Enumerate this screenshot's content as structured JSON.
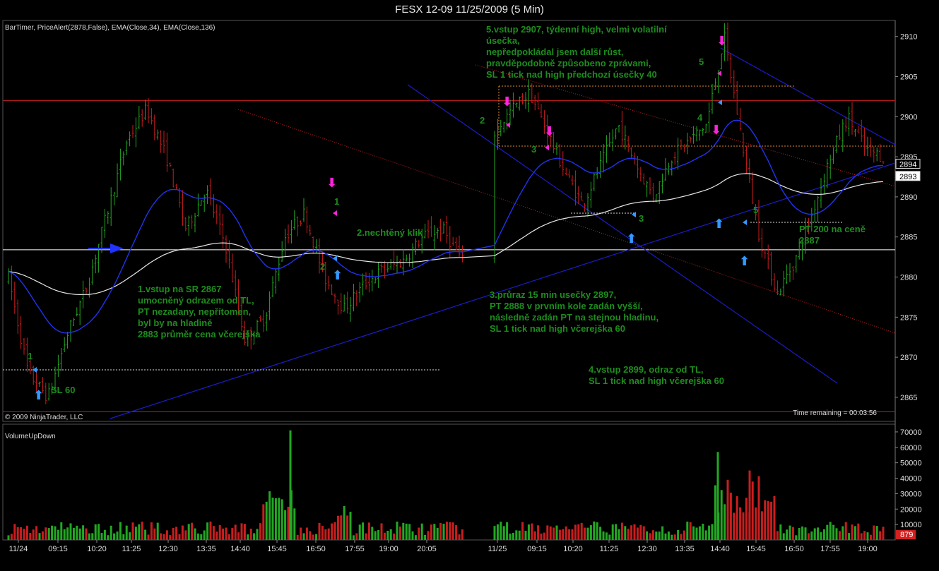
{
  "window": {
    "title": "FESX 12-09  11/25/2009 (5 Min)"
  },
  "colors": {
    "background": "#000000",
    "up_bar": "#22a822",
    "down_bar": "#c81e1e",
    "ema34": "#2233ee",
    "ema136": "#e8e8e8",
    "trendline": "#1c1cc8",
    "annotation": "#1e8c1e",
    "signal_magenta": "#ff22dd",
    "signal_cyan": "#3399ff",
    "hline_red": "#c81e1e",
    "hline_white": "#ffffff"
  },
  "chart_data": [
    {
      "type": "candlestick",
      "name": "price-panel",
      "indicators_label": "BarTimer, PriceAlert(2878,False), EMA(Close,34), EMA(Close,136)",
      "copyright": "© 2009 NinjaTrader, LLC",
      "time_remaining": "Time remaining = 00:03:56",
      "ylim": [
        2862,
        2912
      ],
      "y_ticks": [
        2865,
        2870,
        2875,
        2880,
        2885,
        2890,
        2895,
        2900,
        2905,
        2910
      ],
      "last_price_labels": [
        {
          "value": 2894,
          "text": "2894"
        },
        {
          "value": 2893,
          "text": "2893"
        }
      ],
      "horizontal_lines": [
        {
          "price": 2902.0,
          "color": "red"
        },
        {
          "price": 2883.4,
          "color": "white"
        },
        {
          "price": 2863.2,
          "color": "red"
        }
      ],
      "markers": [
        {
          "text": "1",
          "time": "09:00",
          "price": 2869.5
        },
        {
          "text": "2",
          "time": "17:06",
          "price": 2881.2
        },
        {
          "text": "1",
          "time": "17:12",
          "price": 2889.4
        },
        {
          "text": "2",
          "time": "09:00",
          "price": 2898.4
        },
        {
          "text": "3",
          "time": "09:40",
          "price": 2896.5
        },
        {
          "text": "3",
          "time": "12:05",
          "price": 2887.6
        },
        {
          "text": "4",
          "time": "14:27",
          "price": 2899.5
        },
        {
          "text": "5",
          "time": "14:20",
          "price": 2909.1
        },
        {
          "text": "5",
          "time": "15:20",
          "price": 2888.5
        }
      ],
      "annotations": [
        "1.vstup na SR 2867",
        "umocněný odrazem od TL,",
        "PT nezadany, nepřítomen,",
        "byl by na hladině",
        "2883 průměr cena včerejška",
        "SL 60",
        "2.nechtěný klik",
        "3.průraz 15 min usečky 2897,",
        "PT 2888 v prvním kole zadán vyšší,",
        "následně zadán PT na stejnou hladinu,",
        "SL 1 tick nad high včerejška 60",
        "4.vstup 2899, odraz od TL,",
        "SL 1 tick nad high včerejška 60",
        "5.vstup 2907, týdenní high, velmi volatilní",
        "úsečka,",
        "nepředpokládal jsem další růst,",
        "pravděpodobně způsobeno zprávami,",
        "SL 1 tick nad high předchozí úsečky 40",
        "PT 200 na ceně",
        "2887"
      ],
      "series_shape": [
        {
          "segment": "11/24",
          "path": [
            2880,
            2868,
            2865,
            2873,
            2879,
            2888,
            2897,
            2901,
            2895,
            2886,
            2891,
            2884,
            2872,
            2875,
            2885,
            2888,
            2880,
            2876,
            2879,
            2881,
            2882,
            2885,
            2886,
            2882
          ]
        },
        {
          "segment": "11/25",
          "path": [
            2898,
            2901,
            2903,
            2898,
            2893,
            2889,
            2894,
            2899,
            2894,
            2890,
            2895,
            2897,
            2899,
            2910,
            2897,
            2885,
            2878,
            2882,
            2888,
            2895,
            2900,
            2896,
            2895
          ]
        }
      ]
    },
    {
      "type": "bar",
      "name": "VolumeUpDown",
      "label": "VolumeUpDown",
      "ylim": [
        0,
        75000
      ],
      "y_ticks": [
        10000,
        20000,
        30000,
        40000,
        50000,
        60000,
        70000
      ],
      "current_value_label": "879",
      "peaks": [
        {
          "time": "16:25",
          "value": 71000,
          "direction": "up"
        },
        {
          "time": "14:40",
          "value": 57000,
          "direction": "up"
        },
        {
          "time": "14:50",
          "value": 45000,
          "direction": "down"
        }
      ]
    }
  ],
  "x_axis": {
    "tick_labels": [
      "11/24",
      "09:15",
      "10:20",
      "11:25",
      "12:30",
      "13:35",
      "14:40",
      "15:45",
      "16:50",
      "17:55",
      "19:00",
      "20:05",
      "11/25",
      "09:15",
      "10:20",
      "11:25",
      "12:30",
      "13:35",
      "14:40",
      "15:45",
      "16:50",
      "17:55",
      "19:00"
    ]
  }
}
